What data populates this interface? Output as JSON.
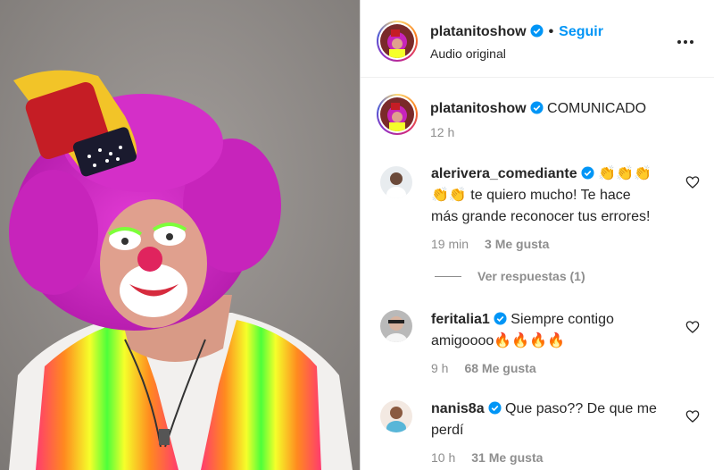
{
  "header": {
    "username": "platanitoshow",
    "separator": "•",
    "follow_label": "Seguir",
    "subtitle": "Audio original",
    "more_icon": "more-horizontal-icon"
  },
  "caption": {
    "username": "platanitoshow",
    "text": "COMUNICADO",
    "time": "12 h"
  },
  "comments": [
    {
      "username": "alerivera_comediante",
      "text_line1": "👏👏👏",
      "text_line2": "👏👏 te quiero mucho! Te hace",
      "text_line3": "más grande reconocer tus errores!",
      "time": "19 min",
      "likes": "3 Me gusta"
    },
    {
      "username": "feritalia1",
      "text_line1": "Siempre contigo",
      "text_line2": "amigoooo🔥🔥🔥🔥",
      "time": "9 h",
      "likes": "68 Me gusta"
    },
    {
      "username": "nanis8a",
      "text_line1": "Que paso?? De que me",
      "text_line2": "perdí",
      "time": "10 h",
      "likes": "31 Me gusta"
    }
  ],
  "view_replies": "Ver respuestas (1)",
  "colors": {
    "follow": "#0095f6",
    "verified": "#0095f6",
    "secondary_text": "#8e8e8e"
  }
}
